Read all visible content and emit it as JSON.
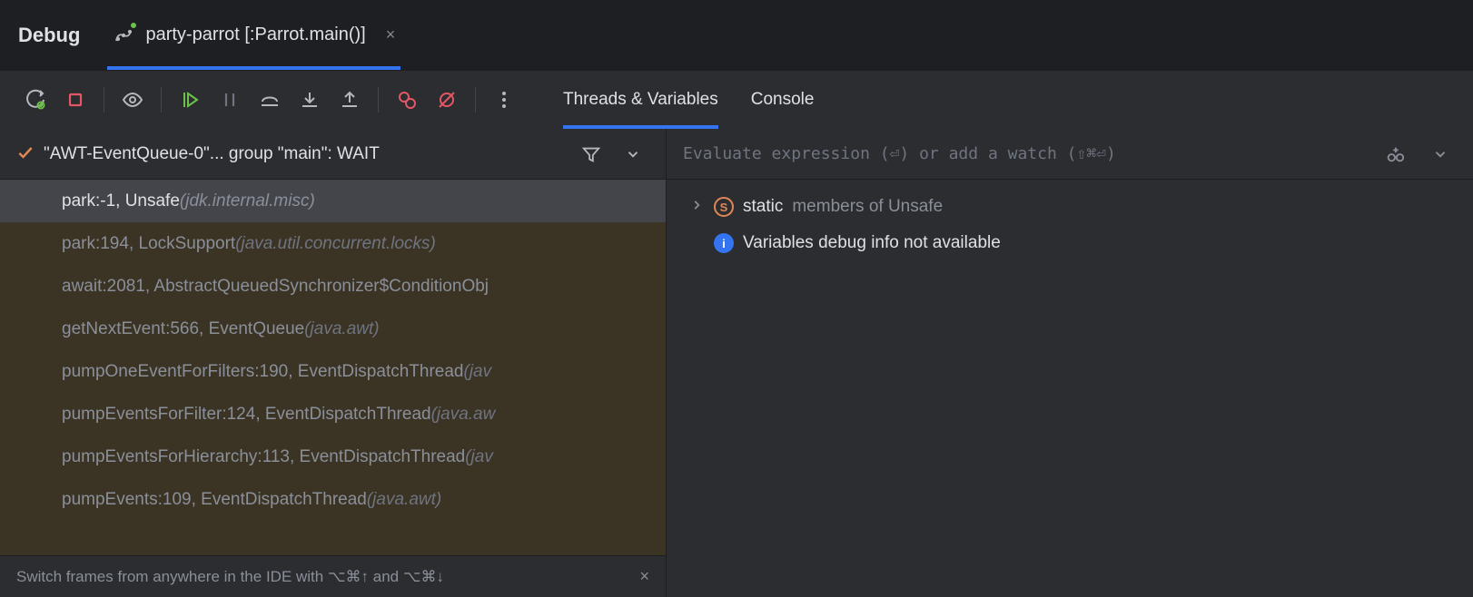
{
  "header": {
    "debug_label": "Debug",
    "run_config": "party-parrot [:Parrot.main()]"
  },
  "toolbar": {
    "inner_tabs": {
      "threads": "Threads & Variables",
      "console": "Console"
    }
  },
  "thread_selector": {
    "label": "\"AWT-EventQueue-0\"... group \"main\": WAIT"
  },
  "frames": [
    {
      "text": "park:-1, Unsafe ",
      "pkg": "(jdk.internal.misc)",
      "selected": true,
      "lib": false
    },
    {
      "text": "park:194, LockSupport ",
      "pkg": "(java.util.concurrent.locks)",
      "selected": false,
      "lib": true
    },
    {
      "text": "await:2081, AbstractQueuedSynchronizer$ConditionObj",
      "pkg": "",
      "selected": false,
      "lib": true
    },
    {
      "text": "getNextEvent:566, EventQueue ",
      "pkg": "(java.awt)",
      "selected": false,
      "lib": true
    },
    {
      "text": "pumpOneEventForFilters:190, EventDispatchThread ",
      "pkg": "(jav",
      "selected": false,
      "lib": true
    },
    {
      "text": "pumpEventsForFilter:124, EventDispatchThread ",
      "pkg": "(java.aw",
      "selected": false,
      "lib": true
    },
    {
      "text": "pumpEventsForHierarchy:113, EventDispatchThread ",
      "pkg": "(jav",
      "selected": false,
      "lib": true
    },
    {
      "text": "pumpEvents:109, EventDispatchThread ",
      "pkg": "(java.awt)",
      "selected": false,
      "lib": true
    }
  ],
  "eval": {
    "placeholder": "Evaluate expression (⏎) or add a watch (⇧⌘⏎)"
  },
  "variables": {
    "row1_primary": "static",
    "row1_secondary": "members of Unsafe",
    "row2_text": "Variables debug info not available"
  },
  "hint": {
    "text": "Switch frames from anywhere in the IDE with ⌥⌘↑ and ⌥⌘↓"
  }
}
